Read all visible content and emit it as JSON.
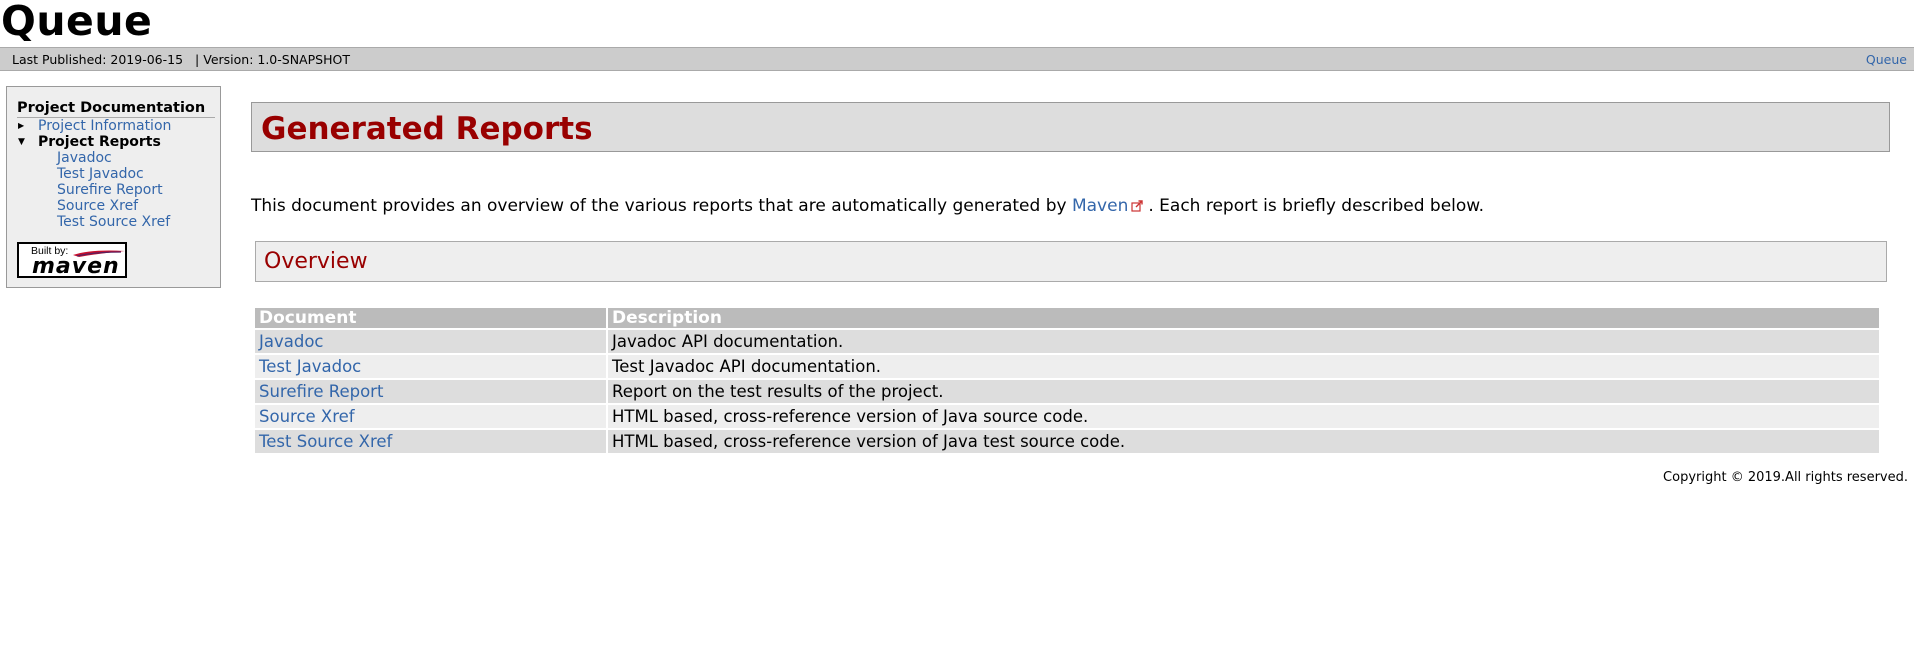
{
  "banner": {
    "title": "Queue"
  },
  "breadcrumbs": {
    "published": "Last Published: 2019-06-15",
    "separator": "|",
    "version": "Version: 1.0-SNAPSHOT",
    "right_link": "Queue"
  },
  "sidebar": {
    "heading": "Project Documentation",
    "project_information": "Project Information",
    "project_reports": "Project Reports",
    "report_items": [
      {
        "label": "Javadoc"
      },
      {
        "label": "Test Javadoc"
      },
      {
        "label": "Surefire Report"
      },
      {
        "label": "Source Xref"
      },
      {
        "label": "Test Source Xref"
      }
    ],
    "powered_by": {
      "built_by": "Built by:",
      "brand": "maven"
    }
  },
  "content": {
    "title": "Generated Reports",
    "intro_before": "This document provides an overview of the various reports that are automatically generated by",
    "intro_link": "Maven",
    "intro_after": ". Each report is briefly described below.",
    "overview_title": "Overview",
    "table": {
      "headers": [
        "Document",
        "Description"
      ],
      "rows": [
        {
          "document": "Javadoc",
          "description": "Javadoc API documentation."
        },
        {
          "document": "Test Javadoc",
          "description": "Test Javadoc API documentation."
        },
        {
          "document": "Surefire Report",
          "description": "Report on the test results of the project."
        },
        {
          "document": "Source Xref",
          "description": "HTML based, cross-reference version of Java source code."
        },
        {
          "document": "Test Source Xref",
          "description": "HTML based, cross-reference version of Java test source code."
        }
      ]
    }
  },
  "footer": {
    "copyright": "Copyright © 2019.All rights reserved."
  },
  "colors": {
    "link": "#3366aa",
    "heading_red": "#990000",
    "bar_gray": "#cccccc"
  }
}
